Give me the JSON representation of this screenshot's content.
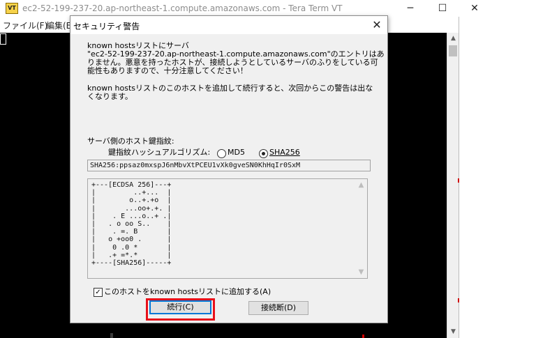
{
  "main_window": {
    "title": "ec2-52-199-237-20.ap-northeast-1.compute.amazonaws.com - Tera Term VT",
    "icon_text": "VT",
    "controls": {
      "minimize": "─",
      "maximize": "☐",
      "close": "✕"
    },
    "menu": [
      "ファイル(F)",
      "編集(E)"
    ]
  },
  "dialog": {
    "title": "セキュリティ警告",
    "close": "✕",
    "message": {
      "line1": "known hostsリストにサーバ",
      "line2": "\"ec2-52-199-237-20.ap-northeast-1.compute.amazonaws.com\"のエントリはあ",
      "line3": "りません。悪意を持ったホストが、接続しようとしているサーバのふりをしている可",
      "line4": "能性もありますので、十分注意してください！",
      "line5": "known hostsリストのこのホストを追加して続行すると、次回からこの警告は出な",
      "line6": "くなります。"
    },
    "fingerprint_label": "サーバ側のホスト鍵指紋:",
    "hash_label": "鍵指紋ハッシュアルゴリズム:",
    "hash_options": [
      "MD5",
      "SHA256"
    ],
    "hash_selected": "SHA256",
    "fingerprint": "SHA256:ppsaz0mxspJ6nMbvXtPCEU1vXk0gveSN0KhHqIr0SxM",
    "randomart": "+---[ECDSA 256]---+\n|         ..+...  |\n|        o..+.+o  |\n|       ...oo+.+. |\n|    . E ...o..+ .|\n|   . o oo S..    |\n|    . =. B       |\n|   o +oo0 .      |\n|    0 .0 *       |\n|   .+ =*.*       |\n+----[SHA256]-----+",
    "add_to_known_hosts": {
      "label": "このホストをknown hostsリストに追加する(A)",
      "checked": true,
      "mark": "✓"
    },
    "continue_button": "続行(C)",
    "disconnect_button": "接続断(D)",
    "highlight_color": "#e8101a",
    "scroll_up": "▲",
    "scroll_down": "▼"
  }
}
